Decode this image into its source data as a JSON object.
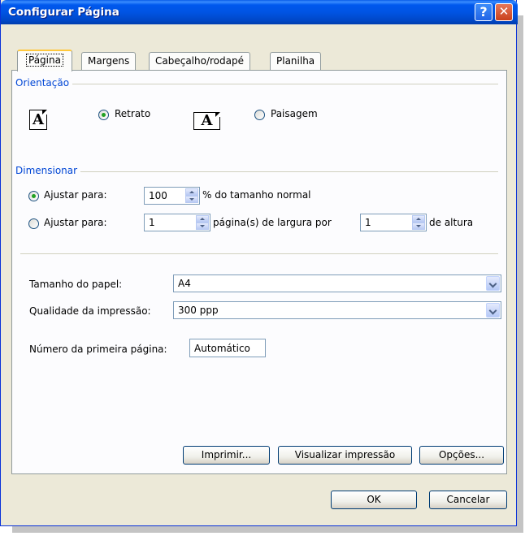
{
  "window": {
    "title": "Configurar Página"
  },
  "tabs": [
    {
      "label": "Página",
      "active": true
    },
    {
      "label": "Margens"
    },
    {
      "label": "Cabeçalho/rodapé"
    },
    {
      "label": "Planilha"
    }
  ],
  "orientation": {
    "group_label": "Orientação",
    "portrait_label": "Retrato",
    "landscape_label": "Paisagem",
    "icon_letter": "A",
    "selected": "Retrato"
  },
  "scaling": {
    "group_label": "Dimensionar",
    "adjust_label_1": "Ajustar para:",
    "adjust_value": "100",
    "adjust_suffix": "% do tamanho normal",
    "adjust_label_2": "Ajustar para:",
    "pages_wide_value": "1",
    "pages_wide_suffix": "página(s) de largura por",
    "pages_tall_value": "1",
    "pages_tall_suffix": "de altura"
  },
  "paper": {
    "paper_size_label": "Tamanho do papel:",
    "paper_size_value": "A4",
    "quality_label": "Qualidade da impressão:",
    "quality_value": "300 ppp",
    "first_page_label": "Número da primeira página:",
    "first_page_value": "Automático"
  },
  "panel_buttons": {
    "print": "Imprimir...",
    "preview": "Visualizar impressão",
    "options": "Opções..."
  },
  "dialog_buttons": {
    "ok": "OK",
    "cancel": "Cancelar"
  },
  "colors": {
    "titlebar": "#0054e3",
    "group_label": "#0046d5",
    "radio_dot": "#21a121",
    "dialog_bg": "#ece9d8"
  }
}
